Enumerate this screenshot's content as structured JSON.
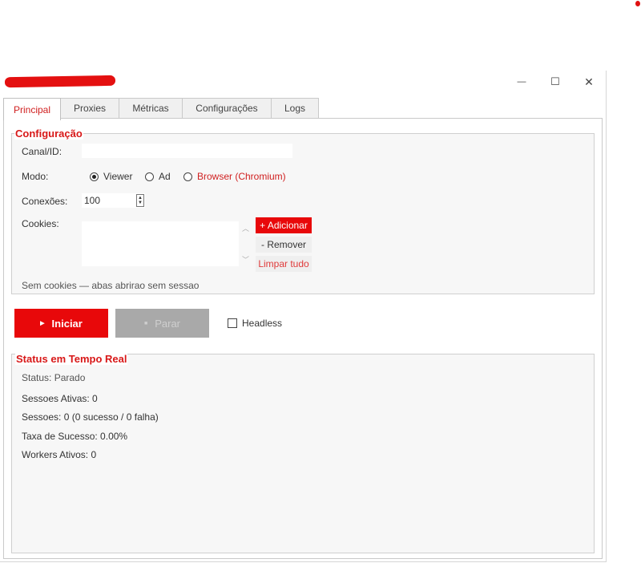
{
  "window": {
    "controls": {
      "minimize": "—",
      "maximize": "☐",
      "close": "✕"
    }
  },
  "tabs": [
    {
      "label": "Principal",
      "active": true
    },
    {
      "label": "Proxies",
      "active": false
    },
    {
      "label": "Métricas",
      "active": false
    },
    {
      "label": "Configurações",
      "active": false
    },
    {
      "label": "Logs",
      "active": false
    }
  ],
  "config": {
    "title": "Configuração",
    "canal_label": "Canal/ID:",
    "canal_value": "",
    "modo_label": "Modo:",
    "modes": [
      {
        "label": "Viewer",
        "selected": true
      },
      {
        "label": "Ad",
        "selected": false
      },
      {
        "label": "Browser (Chromium)",
        "selected": false
      }
    ],
    "conexoes_label": "Conexões:",
    "conexoes_value": "100",
    "cookies_label": "Cookies:",
    "add_button": "+ Adicionar",
    "remove_button": "- Remover",
    "clear_button": "Limpar tudo",
    "cookies_note": "Sem cookies — abas abrirao sem sessao"
  },
  "actions": {
    "start": "Iniciar",
    "start_icon": "▶",
    "stop": "Parar",
    "stop_icon": "■",
    "headless_label": "Headless",
    "headless_checked": false
  },
  "status": {
    "title": "Status em Tempo Real",
    "lines": [
      "Status: Parado",
      "Sessoes Ativas: 0",
      "Sessoes: 0 (0 sucesso / 0 falha)",
      "Taxa de Sucesso: 0.00%",
      "Workers Ativos: 0"
    ]
  },
  "colors": {
    "accent": "#e8080a",
    "accent_text": "#d81818"
  }
}
